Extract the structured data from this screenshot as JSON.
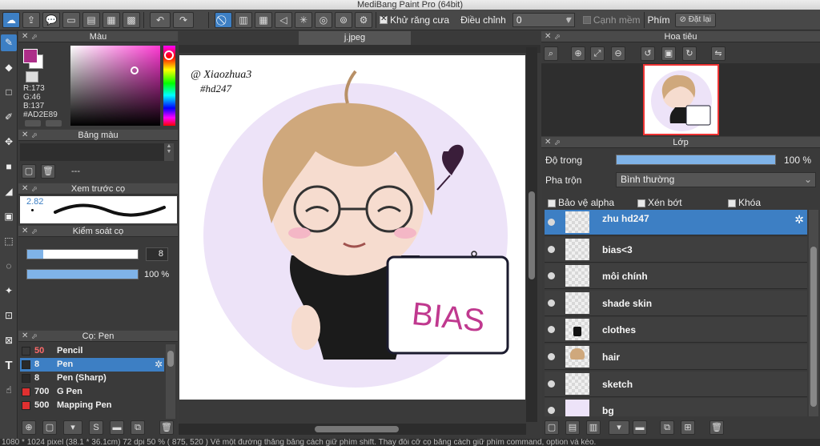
{
  "window": {
    "title": "MediBang Paint Pro (64bit)"
  },
  "toolbar": {
    "antialias_label": "Khử răng cưa",
    "adjust_label": "Điều chỉnh",
    "adjust_value": "0",
    "smooth_edge_label": "Cạnh mềm",
    "shortcut_label": "Phím",
    "reset_label": "Đặt lại"
  },
  "color_panel": {
    "title": "Màu",
    "r": "R:173",
    "g": "G:46",
    "b": "B:137",
    "hex": "#AD2E89",
    "fg_color": "#AD2E89"
  },
  "swatch_panel": {
    "title": "Bảng màu",
    "name": "---"
  },
  "brush_preview": {
    "title": "Xem trước cọ",
    "size": "2.82"
  },
  "brush_control": {
    "title": "Kiểm soát cọ",
    "size_value": "8",
    "opacity_value": "100 %"
  },
  "brush_list": {
    "title": "Cọ: Pen",
    "items": [
      {
        "size": "50",
        "name": "Pencil",
        "color": "#ff6b6b"
      },
      {
        "size": "8",
        "name": "Pen",
        "color": "#ffffff",
        "selected": true
      },
      {
        "size": "8",
        "name": "Pen (Sharp)",
        "color": "#ffffff"
      },
      {
        "size": "700",
        "name": "G Pen",
        "color": "#ff4444"
      },
      {
        "size": "500",
        "name": "Mapping Pen",
        "color": "#ff4444"
      }
    ]
  },
  "canvas": {
    "tab": "j.jpeg",
    "signature_line1": "@ Xiaozhua3",
    "signature_line2": "#hd247",
    "sign_text": "BIAS"
  },
  "navigator": {
    "title": "Hoa tiêu"
  },
  "layer_panel": {
    "title": "Lớp",
    "opacity_label": "Độ trong",
    "opacity_value": "100 %",
    "opacity_fraction": 1.0,
    "blend_label": "Pha trộn",
    "blend_value": "Bình thường",
    "protect_alpha": "Bảo vệ alpha",
    "clipping": "Xén bớt",
    "lock": "Khóa",
    "layers": [
      {
        "name": "zhu hd247",
        "selected": true
      },
      {
        "name": "bias<3"
      },
      {
        "name": "môi chính"
      },
      {
        "name": "shade skin"
      },
      {
        "name": "clothes"
      },
      {
        "name": "hair"
      },
      {
        "name": "sketch"
      },
      {
        "name": "bg"
      }
    ]
  },
  "statusbar": {
    "text": "1080 * 1024 pixel   (38.1 * 36.1cm)   72 dpi   50 %   ( 875, 520 )   Vẽ một đường thẳng bằng cách giữ phím shift. Thay đổi cỡ cọ bằng cách giữ phím command, option và kéo."
  }
}
